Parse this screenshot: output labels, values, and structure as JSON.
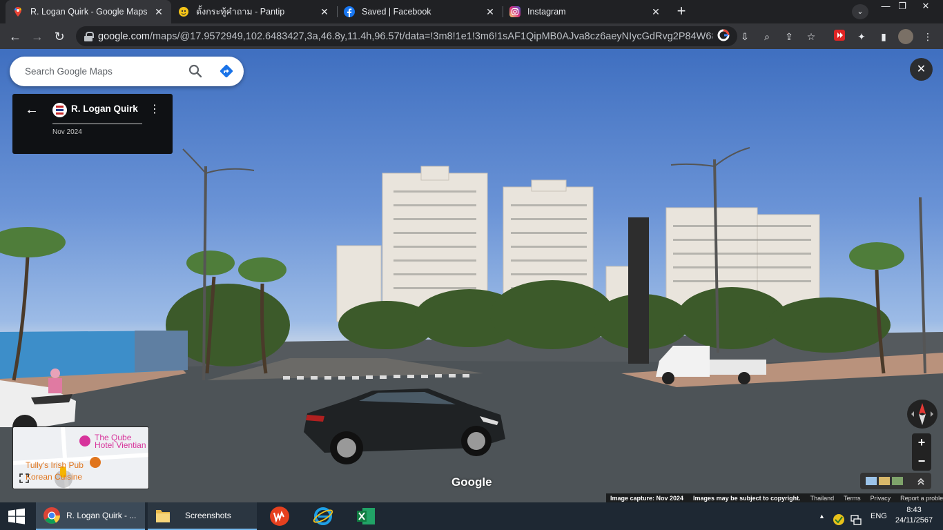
{
  "browser": {
    "tabs": [
      {
        "title": "R. Logan Quirk - Google Maps",
        "favicon": "google-maps-icon",
        "active": true
      },
      {
        "title": "ตั้งกระทู้คำถาม - Pantip",
        "favicon": "pantip-icon",
        "active": false
      },
      {
        "title": "Saved | Facebook",
        "favicon": "facebook-icon",
        "active": false
      },
      {
        "title": "Instagram",
        "favicon": "instagram-icon",
        "active": false
      }
    ],
    "url_domain": "google.com",
    "url_path": "/maps/@17.9572949,102.6483427,3a,46.8y,11.4h,96.57t/data=!3m8!1e1!3m6!1sAF1QipMB0AJva8cz6aeyNIycGdRvg2P84W68FXsh-..."
  },
  "maps": {
    "search_placeholder": "Search Google Maps",
    "place_name": "R. Logan Quirk",
    "capture_date": "Nov 2024",
    "minimap": {
      "poi_hotel": "The Qube Hotel Vientian",
      "poi_pub": "Tully's Irish Pub",
      "poi_korean": "Korean Cuisine"
    },
    "watermark": "Google",
    "footer": {
      "image_capture": "Image capture: Nov 2024",
      "copyright": "Images may be subject to copyright.",
      "country": "Thailand",
      "terms": "Terms",
      "privacy": "Privacy",
      "report": "Report a problem"
    }
  },
  "taskbar": {
    "apps": [
      {
        "label": "R. Logan Quirk - ...",
        "icon": "chrome-icon"
      },
      {
        "label": "Screenshots",
        "icon": "folder-icon"
      }
    ],
    "lang": "ENG",
    "time": "8:43",
    "date": "24/11/2567"
  },
  "colors": {
    "chrome_dark": "#202124",
    "chrome_tab": "#35363a",
    "taskbar": "#1e2833",
    "accent": "#76b9ed"
  }
}
